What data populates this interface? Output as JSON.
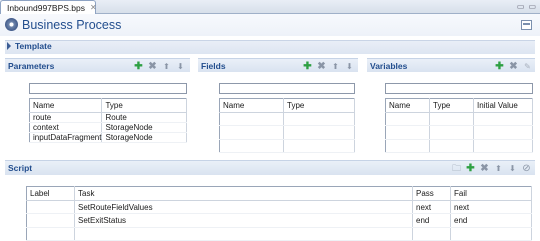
{
  "tab": {
    "title": "Inbound997BPS.bps",
    "close": "✕"
  },
  "window": {
    "minimize": "▭",
    "maximize": "▭"
  },
  "form": {
    "title": "Business Process"
  },
  "template": {
    "label": "Template"
  },
  "parameters": {
    "label": "Parameters",
    "filter_value": "",
    "columns": [
      "Name",
      "Type"
    ],
    "rows": [
      [
        "route",
        "Route"
      ],
      [
        "context",
        "StorageNode"
      ],
      [
        "inputDataFragment",
        "StorageNode"
      ]
    ]
  },
  "fields": {
    "label": "Fields",
    "filter_value": "",
    "columns": [
      "Name",
      "Type"
    ],
    "rows": []
  },
  "variables": {
    "label": "Variables",
    "filter_value": "",
    "columns": [
      "Name",
      "Type",
      "Initial Value"
    ],
    "rows": []
  },
  "script": {
    "label": "Script",
    "columns": [
      "Label",
      "Task",
      "Pass",
      "Fail"
    ],
    "rows": [
      [
        "",
        "SetRouteFieldValues",
        "next",
        "next"
      ],
      [
        "",
        "SetExitStatus",
        "end",
        "end"
      ]
    ]
  },
  "icons": {
    "add": "plus-icon",
    "delete": "x-icon",
    "up": "arrow-up-icon",
    "down": "arrow-down-icon",
    "edit": "pencil-icon",
    "folder": "folder-icon",
    "block": "no-entry-icon"
  }
}
